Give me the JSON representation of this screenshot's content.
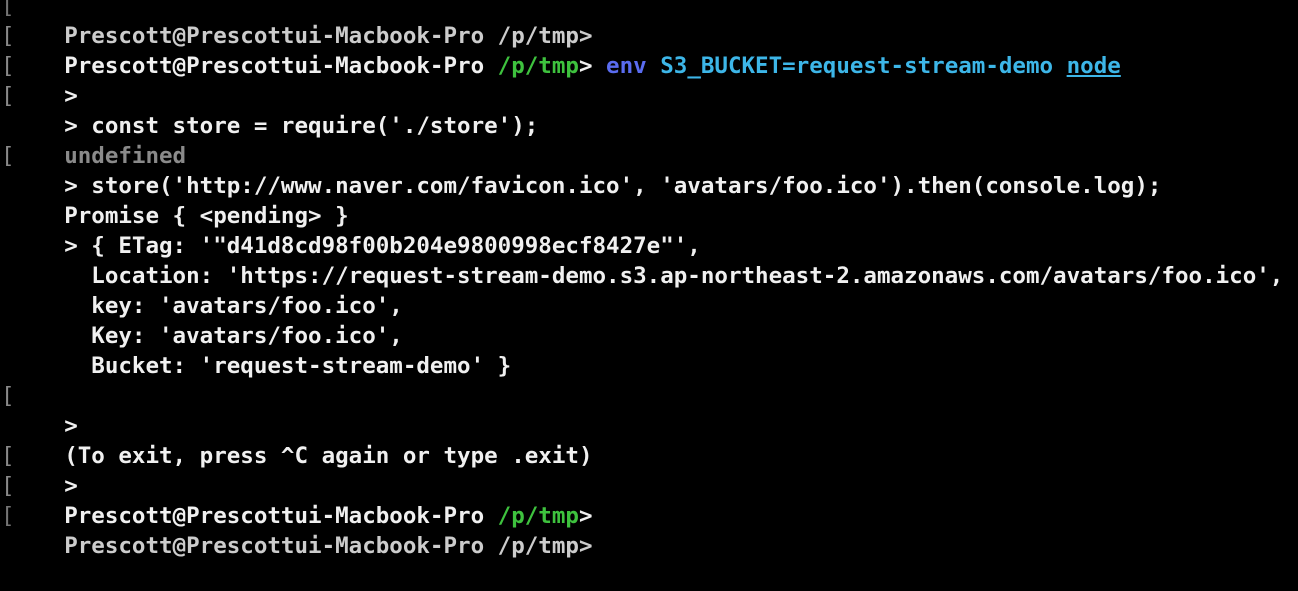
{
  "terminal": {
    "top_partial": {
      "text": "Prescott@Prescottui-Macbook-Pro /p/tmp> "
    },
    "cmd1": {
      "prompt_user": "Prescott@Prescottui-Macbook-Pro ",
      "prompt_path": "/p/tmp",
      "prompt_end": "> ",
      "cmd_env": "env",
      "cmd_var": " S3_BUCKET=request-stream-demo ",
      "cmd_node": "node"
    },
    "repl1": ">",
    "repl2": "> const store = require('./store');",
    "undefined": "undefined",
    "repl3": "> store('http://www.naver.com/favicon.ico', 'avatars/foo.ico').then(console.log);",
    "promise": "Promise { <pending> }",
    "out1": "> { ETag: '\"d41d8cd98f00b204e9800998ecf8427e\"',",
    "out2": "  Location: 'https://request-stream-demo.s3.ap-northeast-2.amazonaws.com/avatars/foo.ico',",
    "out3": "  key: 'avatars/foo.ico',",
    "out4": "  Key: 'avatars/foo.ico',",
    "out5": "  Bucket: 'request-stream-demo' }",
    "blank": "",
    "repl4": ">",
    "exit_msg": "(To exit, press ^C again or type .exit)",
    "repl5": ">",
    "final_prompt": {
      "user": "Prescott@Prescottui-Macbook-Pro ",
      "path": "/p/tmp",
      "end": ">"
    },
    "bracket_char": "["
  },
  "colors": {
    "background": "#000000",
    "text": "#f0f0f0",
    "path": "#3ec23e",
    "env": "#5a6cf0",
    "var": "#3db6e8",
    "muted": "#8a8a8a"
  }
}
